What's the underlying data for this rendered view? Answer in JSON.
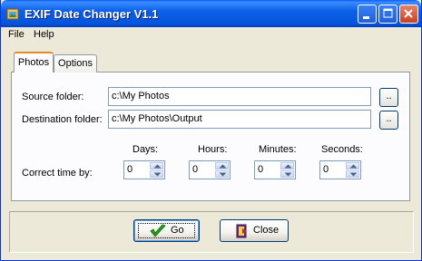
{
  "window": {
    "title": "EXIF Date Changer V1.1"
  },
  "menu": [
    "File",
    "Help"
  ],
  "tabs": [
    {
      "label": "Photos",
      "active": true
    },
    {
      "label": "Options",
      "active": false
    }
  ],
  "photos": {
    "source_label": "Source folder:",
    "source_value": "c:\\My Photos",
    "destination_label": "Destination folder:",
    "destination_value": "c:\\My Photos\\Output",
    "browse_label": "..",
    "correct_time_label": "Correct time by:",
    "fields": [
      {
        "label": "Days:",
        "value": "0"
      },
      {
        "label": "Hours:",
        "value": "0"
      },
      {
        "label": "Minutes:",
        "value": "0"
      },
      {
        "label": "Seconds:",
        "value": "0"
      }
    ]
  },
  "buttons": {
    "go": "Go",
    "close": "Close"
  },
  "colors": {
    "titlebar": "#0653DA",
    "face": "#ECE9D8",
    "go_check": "#2E9B1C"
  },
  "icons": [
    "app-icon",
    "minimize-icon",
    "maximize-icon",
    "close-icon",
    "checkmark-icon",
    "exit-door-icon",
    "spin-up-arrow-icon",
    "spin-down-arrow-icon"
  ]
}
